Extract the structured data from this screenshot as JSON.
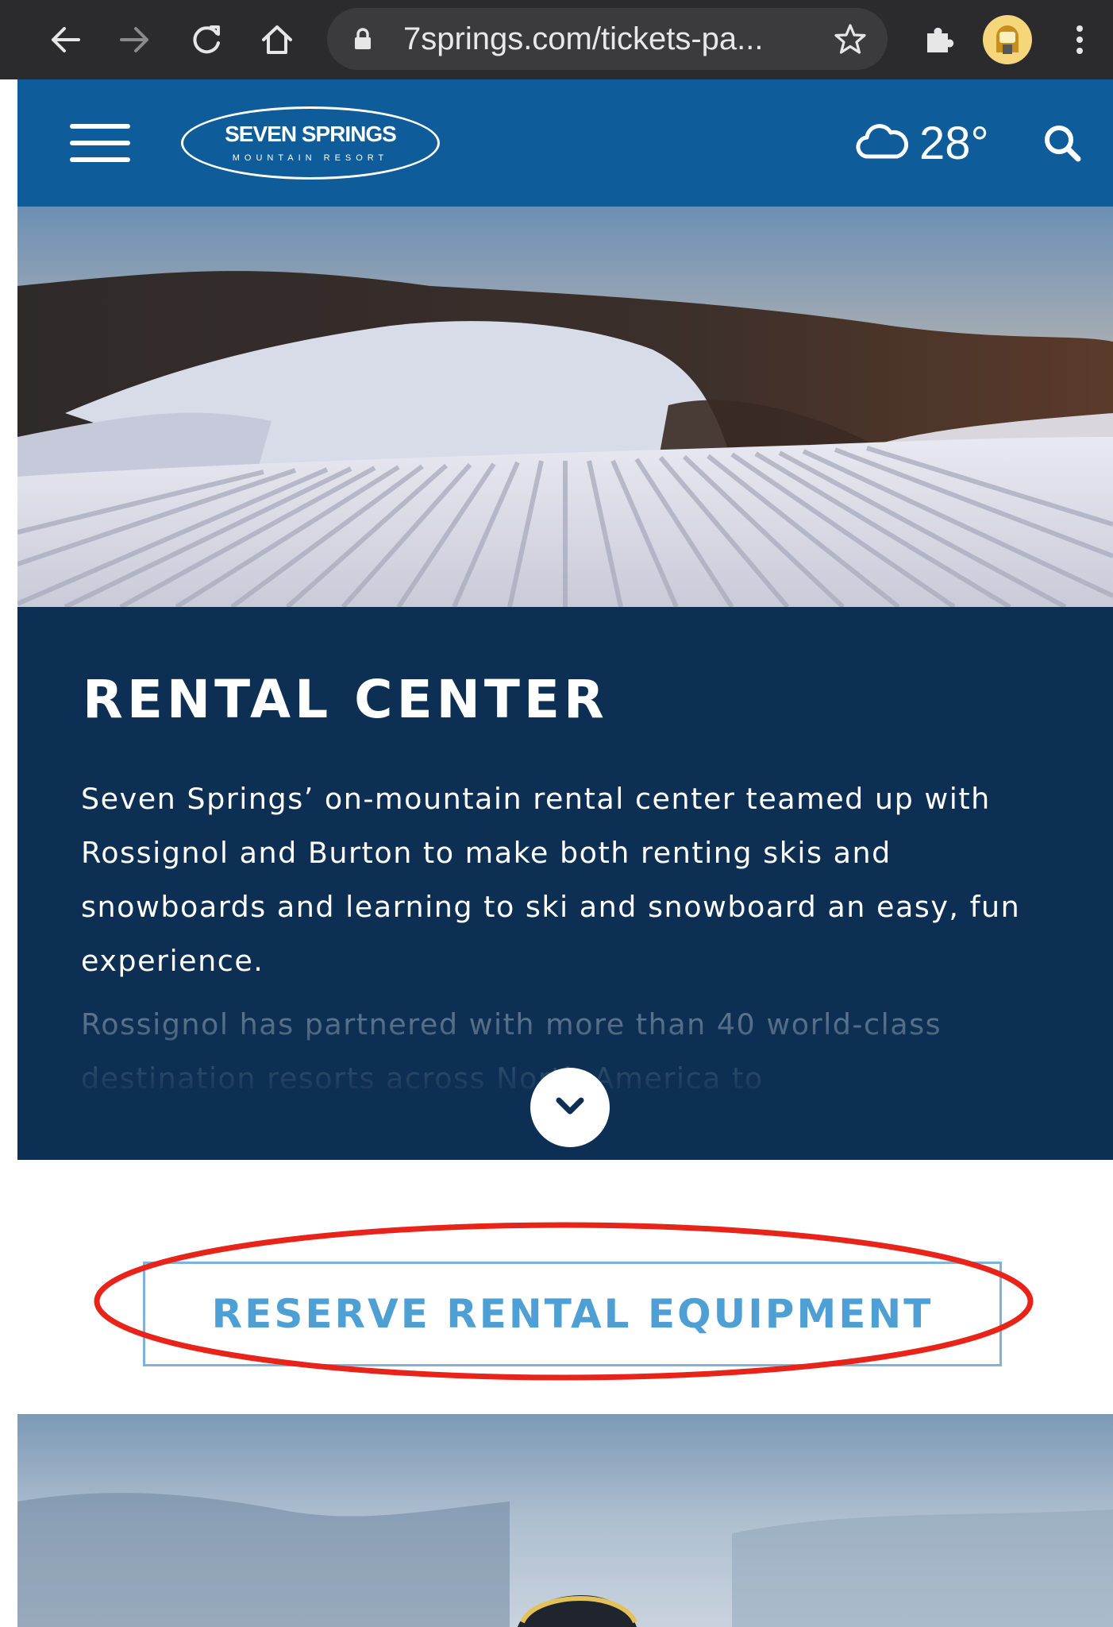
{
  "browser": {
    "url": "7springs.com/tickets-pa...",
    "icons": [
      "back-arrow-icon",
      "forward-arrow-icon",
      "reload-icon",
      "home-icon",
      "lock-icon",
      "bookmark-star-icon",
      "extensions-puzzle-icon",
      "profile-avatar-icon",
      "kebab-menu-icon"
    ]
  },
  "header": {
    "logo_main": "SEVEN SPRINGS",
    "logo_sub": "MOUNTAIN RESORT",
    "temperature": "28°",
    "weather_icon": "cloud-icon",
    "brand_color": "#0f5c9a"
  },
  "rental": {
    "title": "RENTAL CENTER",
    "intro": "Seven Springs’ on-mountain rental center teamed up with Rossignol and Burton to make both renting skis and snowboards and learning to ski and snowboard an easy, fun experience.",
    "more": "Rossignol has partnered with more than 40 world-class destination resorts across North America to",
    "section_color": "#0c2f53"
  },
  "reserve": {
    "button_label": "RESERVE RENTAL EQUIPMENT",
    "highlight_color": "#e8231a"
  }
}
